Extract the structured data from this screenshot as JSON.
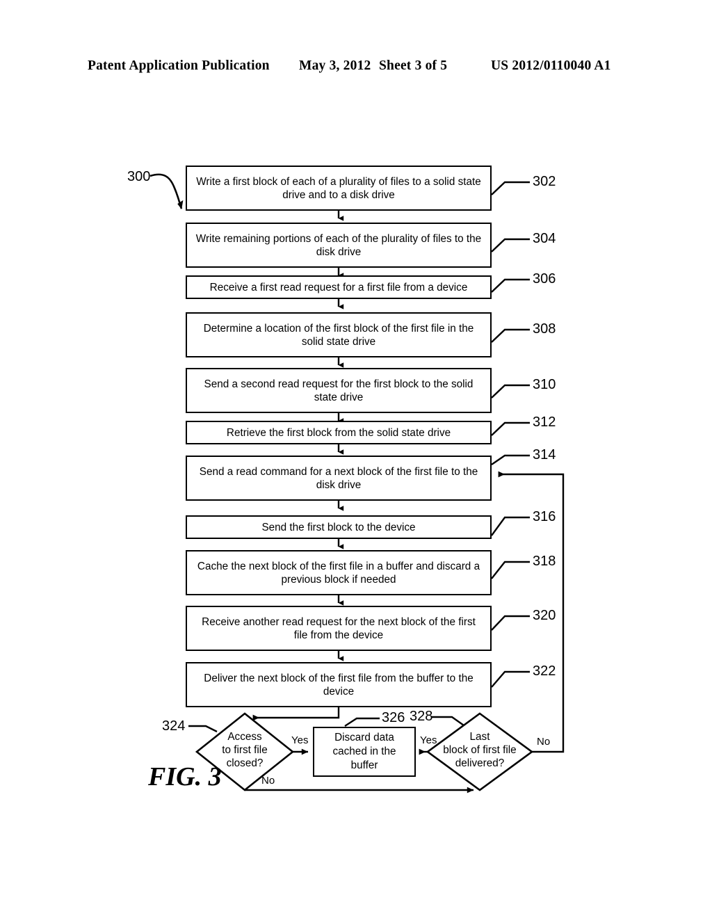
{
  "header": {
    "publication": "Patent Application Publication",
    "date": "May 3, 2012",
    "sheet": "Sheet 3 of 5",
    "patent_number": "US 2012/0110040 A1"
  },
  "figure": {
    "caption": "FIG. 3",
    "flow_label": "300",
    "line_color": "#000000",
    "background_color": "#ffffff"
  },
  "steps": [
    {
      "ref": "302",
      "text": "Write a first block of each of a plurality of files to a solid state drive and to a disk drive"
    },
    {
      "ref": "304",
      "text": "Write remaining portions of each of the plurality of files to the disk drive"
    },
    {
      "ref": "306",
      "text": "Receive a first read request for a first file from a device"
    },
    {
      "ref": "308",
      "text": "Determine a location of the first block of the first file in the solid state drive"
    },
    {
      "ref": "310",
      "text": "Send a second read request for the first block to the solid state drive"
    },
    {
      "ref": "312",
      "text": "Retrieve the first block from the solid state drive"
    },
    {
      "ref": "314",
      "text": "Send a read command for a next block of the first file to the disk drive"
    },
    {
      "ref": "316",
      "text": "Send the first block to the device"
    },
    {
      "ref": "318",
      "text": "Cache the next block of the first file in a buffer and discard a previous block if needed"
    },
    {
      "ref": "320",
      "text": "Receive another read request for the next block of the first file from the device"
    },
    {
      "ref": "322",
      "text": "Deliver the next block of the first file from the buffer to the device"
    }
  ],
  "decisions": [
    {
      "ref": "324",
      "line1": "Access",
      "line2": "to first file",
      "line3": "closed?",
      "yes_label": "Yes",
      "no_label": "No"
    },
    {
      "ref": "328",
      "line1": "Last",
      "line2": "block of first file",
      "line3": "delivered?",
      "yes_label": "Yes",
      "no_label": "No"
    }
  ],
  "terminal_box": {
    "ref": "326",
    "line1": "Discard data",
    "line2": "cached in the",
    "line3": "buffer"
  }
}
